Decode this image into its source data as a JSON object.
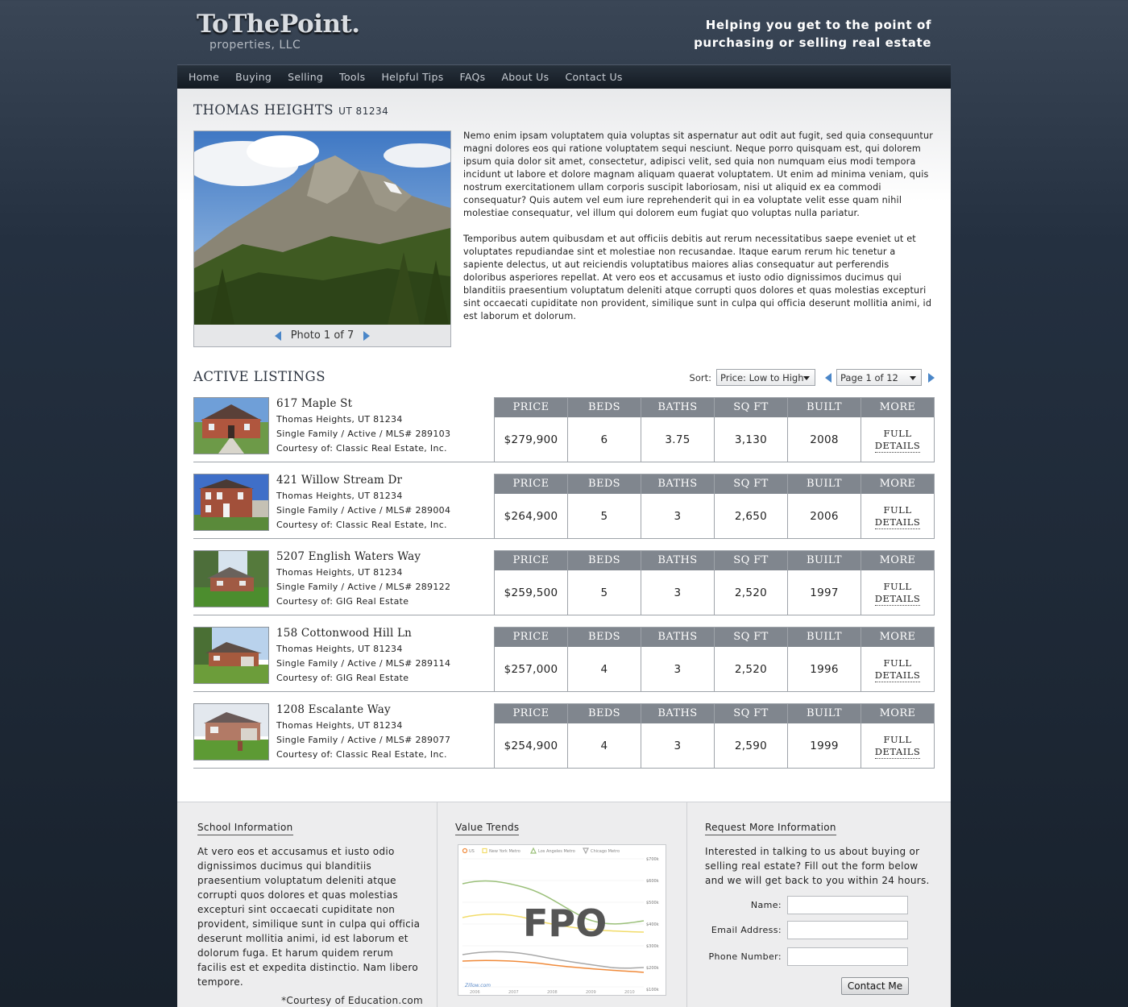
{
  "brand": {
    "name": "ToThePoint.",
    "sub": "properties, LLC",
    "tagline": "Helping you get to the point of purchasing or selling real estate"
  },
  "nav": [
    "Home",
    "Buying",
    "Selling",
    "Tools",
    "Helpful Tips",
    "FAQs",
    "About Us",
    "Contact Us"
  ],
  "city": {
    "name": "THOMAS HEIGHTS",
    "zip": "UT 81234"
  },
  "photo": {
    "caption": "Photo 1 of 7"
  },
  "description": [
    "Nemo enim ipsam voluptatem quia voluptas sit aspernatur aut odit aut fugit, sed quia consequuntur magni dolores eos qui ratione voluptatem sequi nesciunt. Neque porro quisquam est, qui dolorem ipsum quia dolor sit amet, consectetur, adipisci velit, sed quia non numquam eius modi tempora incidunt ut labore et dolore magnam aliquam quaerat voluptatem. Ut enim ad minima veniam, quis nostrum exercitationem ullam corporis suscipit laboriosam, nisi ut aliquid ex ea commodi consequatur? Quis autem vel eum iure reprehenderit qui in ea voluptate velit esse quam nihil molestiae consequatur, vel illum qui dolorem eum fugiat quo voluptas nulla pariatur.",
    "Temporibus autem quibusdam et aut officiis debitis aut rerum necessitatibus saepe eveniet ut et voluptates repudiandae sint et molestiae non recusandae. Itaque earum rerum hic tenetur a sapiente delectus, ut aut reiciendis voluptatibus maiores alias consequatur aut perferendis doloribus asperiores repellat. At vero eos et accusamus et iusto odio dignissimos ducimus qui blanditiis praesentium voluptatum deleniti atque corrupti quos dolores et quas molestias excepturi sint occaecati cupiditate non provident, similique sunt in culpa qui officia deserunt mollitia animi, id est laborum et dolorum."
  ],
  "listings_section": {
    "title": "ACTIVE LISTINGS",
    "sort_label": "Sort:",
    "sort_value": "Price: Low to High",
    "page_value": "Page 1 of 12"
  },
  "columns": [
    "PRICE",
    "BEDS",
    "BATHS",
    "SQ FT",
    "BUILT",
    "MORE"
  ],
  "more_label": [
    "FULL",
    "DETAILS"
  ],
  "listings": [
    {
      "address": "617 Maple St",
      "city": "Thomas Heights, UT 81234",
      "type": "Single Family / Active / MLS# 289103",
      "courtesy": "Courtesy of: Classic Real Estate, Inc.",
      "price": "$279,900",
      "beds": "6",
      "baths": "3.75",
      "sqft": "3,130",
      "built": "2008"
    },
    {
      "address": "421 Willow Stream Dr",
      "city": "Thomas Heights, UT 81234",
      "type": "Single Family / Active / MLS# 289004",
      "courtesy": "Courtesy of: Classic Real Estate, Inc.",
      "price": "$264,900",
      "beds": "5",
      "baths": "3",
      "sqft": "2,650",
      "built": "2006"
    },
    {
      "address": "5207 English Waters Way",
      "city": "Thomas Heights, UT 81234",
      "type": "Single Family / Active / MLS# 289122",
      "courtesy": "Courtesy of: GIG Real Estate",
      "price": "$259,500",
      "beds": "5",
      "baths": "3",
      "sqft": "2,520",
      "built": "1997"
    },
    {
      "address": "158 Cottonwood Hill Ln",
      "city": "Thomas Heights, UT 81234",
      "type": "Single Family / Active / MLS# 289114",
      "courtesy": "Courtesy of: GIG Real Estate",
      "price": "$257,000",
      "beds": "4",
      "baths": "3",
      "sqft": "2,520",
      "built": "1996"
    },
    {
      "address": "1208 Escalante Way",
      "city": "Thomas Heights, UT 81234",
      "type": "Single Family / Active / MLS# 289077",
      "courtesy": "Courtesy of: Classic Real Estate, Inc.",
      "price": "$254,900",
      "beds": "4",
      "baths": "3",
      "sqft": "2,590",
      "built": "1999"
    }
  ],
  "school": {
    "title": "School Information",
    "text": "At vero eos et accusamus et iusto odio dignissimos ducimus qui blanditiis praesentium voluptatum deleniti atque corrupti quos dolores et quas molestias excepturi sint occaecati cupiditate non provident, similique sunt in culpa qui officia deserunt mollitia animi, id est laborum et dolorum fuga. Et harum quidem rerum facilis est et expedita distinctio. Nam libero tempore.",
    "credit": "*Courtesy of Education.com"
  },
  "trends": {
    "title": "Value Trends",
    "placeholder": "FPO",
    "legend": [
      "US",
      "New York Metro",
      "Los Angeles Metro",
      "Chicago Metro"
    ],
    "y_ticks": [
      "$700k",
      "$600k",
      "$500k",
      "$400k",
      "$300k",
      "$200k",
      "$100k"
    ],
    "x_ticks": [
      "2006",
      "2007",
      "2008",
      "2009",
      "2010"
    ],
    "watermark": "Zillow.com",
    "series_colors": {
      "us": "#f08a3a",
      "ny": "#f2dc6a",
      "la": "#9bc07a",
      "chicago": "#a8a8a8"
    }
  },
  "request": {
    "title": "Request More Information",
    "text": "Interested in talking to us about buying or selling real estate? Fill out the form below and we will get back to you within 24 hours.",
    "fields": [
      "Name:",
      "Email Address:",
      "Phone Number:"
    ],
    "button": "Contact Me"
  }
}
